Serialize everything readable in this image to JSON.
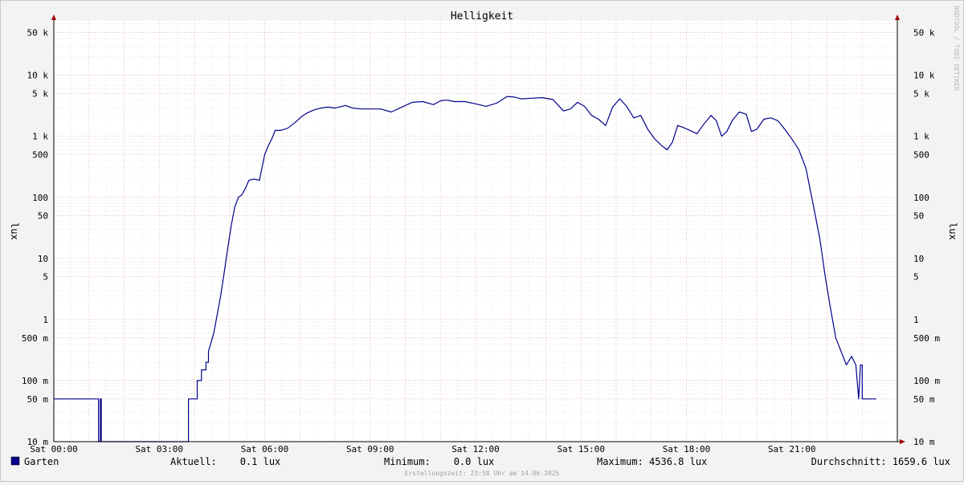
{
  "chart_data": {
    "type": "line",
    "title": "Helligkeit",
    "ylabel": "lux",
    "y_scale": "log",
    "ylim": [
      0.01,
      80000
    ],
    "xlim_hours": [
      0,
      24
    ],
    "y_ticks": [
      {
        "v": 0.01,
        "label": "10 m"
      },
      {
        "v": 0.05,
        "label": "50 m"
      },
      {
        "v": 0.1,
        "label": "100 m"
      },
      {
        "v": 0.5,
        "label": "500 m"
      },
      {
        "v": 1,
        "label": "1"
      },
      {
        "v": 5,
        "label": "5"
      },
      {
        "v": 10,
        "label": "10"
      },
      {
        "v": 50,
        "label": "50"
      },
      {
        "v": 100,
        "label": "100"
      },
      {
        "v": 500,
        "label": "500"
      },
      {
        "v": 1000,
        "label": "1 k"
      },
      {
        "v": 5000,
        "label": "5 k"
      },
      {
        "v": 10000,
        "label": "10 k"
      },
      {
        "v": 50000,
        "label": "50 k"
      }
    ],
    "x_ticks": [
      {
        "h": 0,
        "label": "Sat 00:00"
      },
      {
        "h": 3,
        "label": "Sat 03:00"
      },
      {
        "h": 6,
        "label": "Sat 06:00"
      },
      {
        "h": 9,
        "label": "Sat 09:00"
      },
      {
        "h": 12,
        "label": "Sat 12:00"
      },
      {
        "h": 15,
        "label": "Sat 15:00"
      },
      {
        "h": 18,
        "label": "Sat 18:00"
      },
      {
        "h": 21,
        "label": "Sat 21:00"
      }
    ],
    "grid": true,
    "series": [
      {
        "name": "Garten",
        "color": "#00008b",
        "x_hours": [
          0,
          1.27,
          1.27,
          1.32,
          1.32,
          1.35,
          1.35,
          3.83,
          3.83,
          4.08,
          4.08,
          4.2,
          4.2,
          4.33,
          4.33,
          4.4,
          4.4,
          4.55,
          4.65,
          4.75,
          4.85,
          4.95,
          5.05,
          5.15,
          5.25,
          5.35,
          5.45,
          5.55,
          5.7,
          5.85,
          6.0,
          6.1,
          6.2,
          6.3,
          6.45,
          6.65,
          6.85,
          7.05,
          7.2,
          7.4,
          7.6,
          7.8,
          8.0,
          8.3,
          8.5,
          8.75,
          9.0,
          9.3,
          9.6,
          9.9,
          10.2,
          10.5,
          10.8,
          11.0,
          11.1,
          11.2,
          11.4,
          11.7,
          12.0,
          12.3,
          12.6,
          12.9,
          13.1,
          13.3,
          13.6,
          13.9,
          14.2,
          14.5,
          14.7,
          14.9,
          15.1,
          15.3,
          15.5,
          15.7,
          15.9,
          16.1,
          16.3,
          16.5,
          16.7,
          16.9,
          17.1,
          17.3,
          17.45,
          17.6,
          17.75,
          17.9,
          18.1,
          18.3,
          18.5,
          18.7,
          18.85,
          19.0,
          19.15,
          19.3,
          19.5,
          19.7,
          19.85,
          20.0,
          20.2,
          20.4,
          20.6,
          20.8,
          21.0,
          21.2,
          21.4,
          21.6,
          21.8,
          21.95,
          22.1,
          22.25,
          22.4,
          22.55,
          22.7,
          22.82,
          22.82,
          22.9,
          22.9,
          22.95,
          23.0,
          23.0,
          23.25,
          23.25,
          23.4,
          23.4,
          23.65,
          23.65,
          24.0
        ],
        "y_lux": [
          0.05,
          0.05,
          0.01,
          0.01,
          0.05,
          0.05,
          0.01,
          0.01,
          0.05,
          0.05,
          0.1,
          0.1,
          0.15,
          0.15,
          0.2,
          0.2,
          0.3,
          0.6,
          1.2,
          2.5,
          6,
          15,
          35,
          70,
          100,
          110,
          140,
          190,
          200,
          190,
          500,
          700,
          900,
          1250,
          1250,
          1350,
          1650,
          2100,
          2400,
          2700,
          2900,
          3000,
          2900,
          3200,
          2900,
          2800,
          2800,
          2800,
          2500,
          3000,
          3600,
          3700,
          3300,
          3800,
          3900,
          3900,
          3700,
          3700,
          3400,
          3100,
          3500,
          4500,
          4400,
          4100,
          4200,
          4300,
          4000,
          2600,
          2800,
          3600,
          3100,
          2200,
          1900,
          1500,
          3000,
          4100,
          3100,
          2000,
          2200,
          1300,
          900,
          700,
          600,
          800,
          1500,
          1400,
          1250,
          1100,
          1600,
          2200,
          1800,
          1000,
          1200,
          1800,
          2500,
          2300,
          1200,
          1300,
          1900,
          2000,
          1800,
          1300,
          900,
          600,
          300,
          80,
          20,
          5,
          1.5,
          0.5,
          0.3,
          0.18,
          0.25,
          0.18,
          0.18,
          0.05,
          0.05,
          0.18,
          0.18,
          0.05,
          0.05,
          0.05,
          0.05
        ]
      }
    ]
  },
  "legend": {
    "series_name": "Garten",
    "current": "Aktuell:    0.1 lux",
    "minimum": "Minimum:    0.0 lux",
    "maximum": "Maximum: 4536.8 lux",
    "average": "Durchschnitt: 1659.6 lux"
  },
  "footer": "Erstellungszeit: 23:58 Uhr am 14.06.2025",
  "watermark": "RRDTOOL / TOBI OETIKER"
}
